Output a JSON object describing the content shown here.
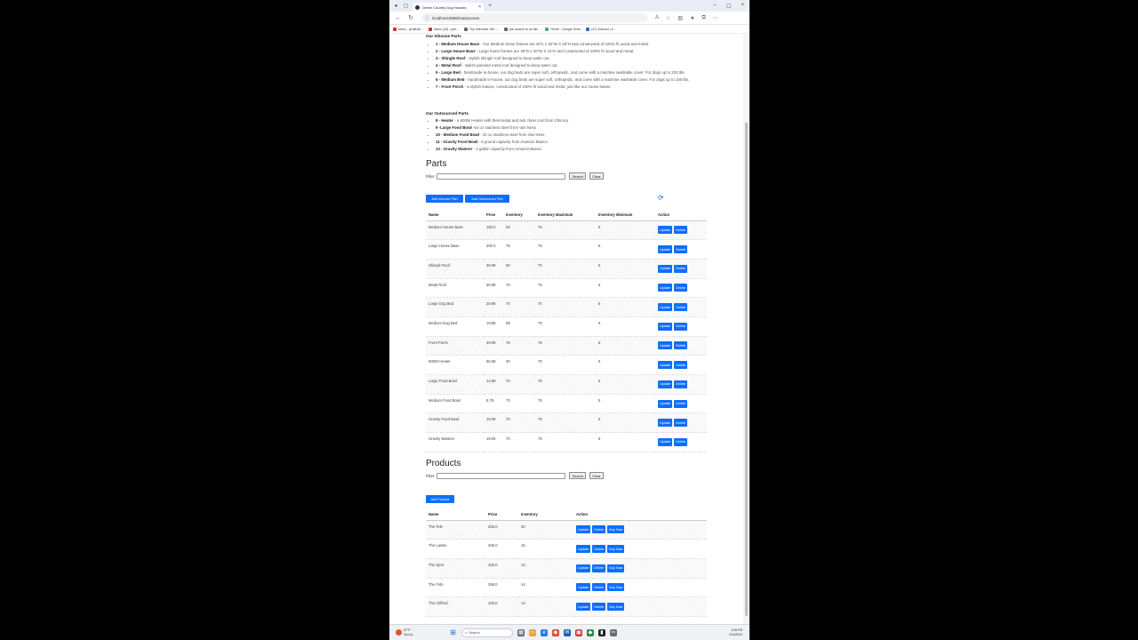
{
  "browser": {
    "tab_title": "Green Country Dog Houses",
    "url": "localhost:8080/mainscreen",
    "bookmarks": [
      "Inbox - jsmith@...",
      "Inbox (10) - jsm...",
      "Top Interview 150 -...",
      "job search to do list...",
      "Home - Google Drive",
      "(47) Discord | #..."
    ]
  },
  "inhouse": {
    "heading": "Our Inhouse Parts",
    "items": [
      {
        "name": "1 - Medium House Base",
        "desc": " - Our Medium home frames are 40\"L x 32\"W X 33\"H and constructed of 100% fir wood and metal."
      },
      {
        "name": "2 - Large House Base",
        "desc": " - Large home frames are 48\"D x 40\"W X 41\"H and constructed of 100% fir wood and metal."
      },
      {
        "name": "3 - Shingle Roof",
        "desc": " - stylish shingle roof designed to keep water out."
      },
      {
        "name": "4 - Metal Roof",
        "desc": " - stylish paneled metal roof designed to keep water out."
      },
      {
        "name": "5 - Large Bed",
        "desc": " - handmade in-house, our dog beds are super soft, orthopedic, and come with a machine washable cover. For dogs up to 220 lbs."
      },
      {
        "name": "6 - Medium Bed",
        "desc": " - handmade in-house, our dog beds are super soft, orthopedic, and come with a machine washable cover. For dogs up to 150 lbs."
      },
      {
        "name": "7 - Front Porch",
        "desc": " - a stylish feature, constructed of 100% fir wood and metal, just like our house bases."
      }
    ]
  },
  "outsourced": {
    "heading": "Our Outsourced Parts",
    "items": [
      {
        "name": "8 - Heater",
        "desc": " - a 600W Heater with thermostat and anti chew cord from Chicocy"
      },
      {
        "name": "9 -Large Food Bowl",
        "desc": " -64 oz stainless steel from Van Ness"
      },
      {
        "name": "10 - Medium Food Bowl",
        "desc": " - 32 oz stainless steel from Van Ness"
      },
      {
        "name": "11 - Gravity Food Bowl",
        "desc": " - 6 pound capacity from Amazon Basics"
      },
      {
        "name": "12 - Gravity Waterer",
        "desc": " - 1 gallon capacity from Amazon Basics"
      }
    ]
  },
  "parts": {
    "title": "Parts",
    "filter_label": "Filter:",
    "search_label": "Search",
    "clear_label": "Clear",
    "add_inhouse_label": "Add Inhouse Part",
    "add_outsourced_label": "Add Outsourced Part",
    "columns": [
      "Name",
      "Price",
      "Inventory",
      "Inventory Maximum",
      "Inventory Minimum",
      "Action"
    ],
    "update_label": "Update",
    "delete_label": "Delete",
    "rows": [
      [
        "Medium House Base",
        "150.0",
        "59",
        "75",
        "5"
      ],
      [
        "Large House Base",
        "200.0",
        "75",
        "75",
        "5"
      ],
      [
        "Shingle Roof",
        "39.99",
        "50",
        "75",
        "5"
      ],
      [
        "Metal Roof",
        "49.99",
        "70",
        "75",
        "5"
      ],
      [
        "Large Dog Bed",
        "29.99",
        "70",
        "75",
        "5"
      ],
      [
        "Medium Dog Bed",
        "19.99",
        "59",
        "75",
        "5"
      ],
      [
        "Front Porch",
        "49.99",
        "75",
        "75",
        "5"
      ],
      [
        "600W Heater",
        "55.99",
        "40",
        "75",
        "5"
      ],
      [
        "Large Food Bowl",
        "12.99",
        "70",
        "75",
        "5"
      ],
      [
        "Medium Food Bowl",
        "8.79",
        "70",
        "75",
        "5"
      ],
      [
        "Gravity Food Bowl",
        "18.99",
        "70",
        "75",
        "5"
      ],
      [
        "Gravity Waterer",
        "19.94",
        "70",
        "75",
        "5"
      ]
    ]
  },
  "products": {
    "title": "Products",
    "filter_label": "Filter:",
    "search_label": "Search",
    "clear_label": "Clear",
    "add_label": "Add Product",
    "columns": [
      "Name",
      "Price",
      "Inventory",
      "Action"
    ],
    "update_label": "Update",
    "delete_label": "Delete",
    "buy_label": "Buy Now",
    "rows": [
      [
        "The Tele",
        "266.0",
        "20"
      ],
      [
        "The Lassie",
        "205.0",
        "15"
      ],
      [
        "The Spot",
        "326.0",
        "14"
      ],
      [
        "The Fido",
        "258.0",
        "14"
      ],
      [
        "The Clifford",
        "425.0",
        "14"
      ]
    ]
  },
  "taskbar": {
    "weather_temp": "67°F",
    "weather_desc": "Sunny",
    "search_placeholder": "Search",
    "time": "3:08 PM",
    "date": "2/16/2024"
  }
}
